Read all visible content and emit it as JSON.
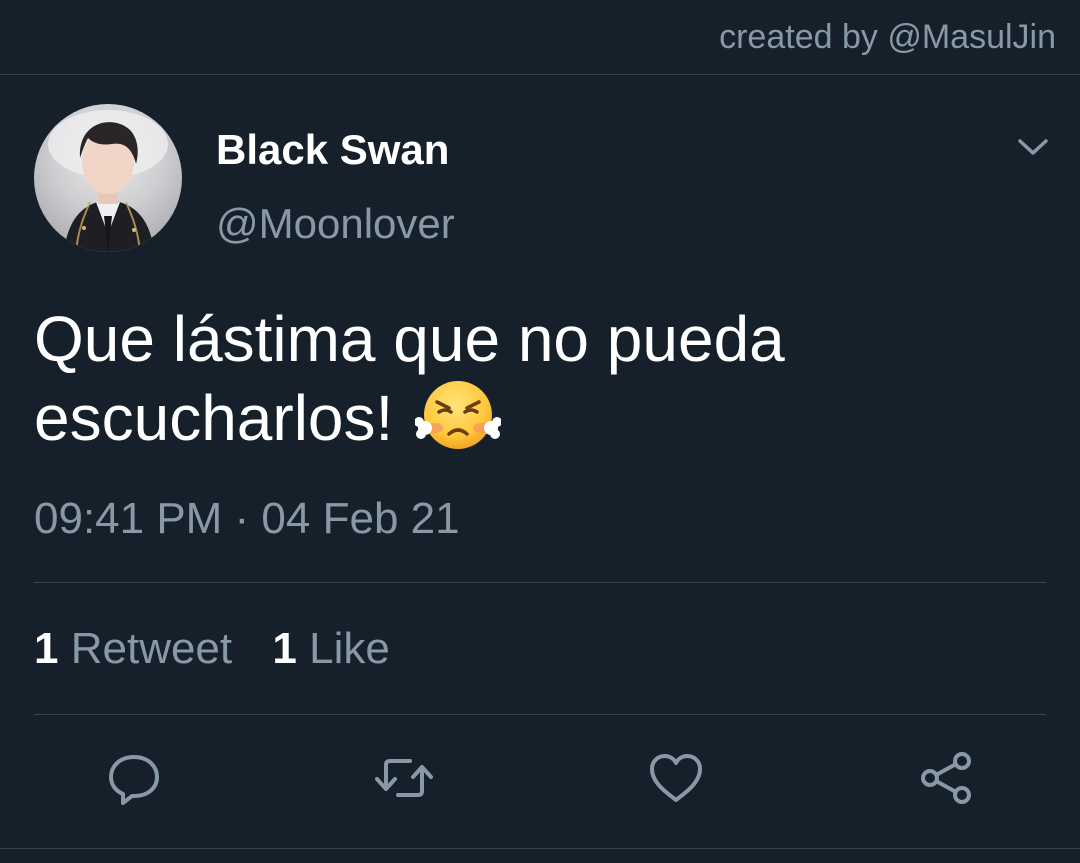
{
  "header": {
    "credit": "created by @MasulJin"
  },
  "tweet": {
    "display_name": "Black Swan",
    "handle": "@Moonlover",
    "text": "Que lástima que no pueda escucharlos!",
    "emoji": "face-with-steam-from-nose",
    "timestamp": "09:41 PM · 04 Feb 21",
    "retweet_count": "1",
    "retweet_label": "Retweet",
    "like_count": "1",
    "like_label": "Like"
  },
  "actions": [
    "reply-icon",
    "retweet-icon",
    "like-icon",
    "share-icon"
  ],
  "colors": {
    "background": "#15202b",
    "divider": "#38444d",
    "secondary_text": "#8899a6",
    "primary_text": "#ffffff"
  }
}
